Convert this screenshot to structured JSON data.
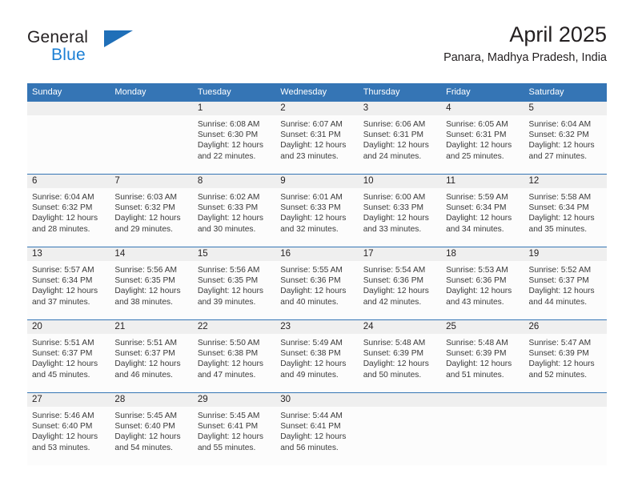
{
  "brand": {
    "name_part1": "General",
    "name_part2": "Blue",
    "accent_color": "#1f6fb8",
    "blue_text_color": "#1b7fd4",
    "logo_icon": "triangle-icon"
  },
  "header": {
    "title": "April 2025",
    "subtitle": "Panara, Madhya Pradesh, India"
  },
  "theme": {
    "header_blue": "#3575b5",
    "daynum_band_gray": "#efefef",
    "cell_background": "#fcfcfc"
  },
  "calendar": {
    "weekday_headers": [
      "Sunday",
      "Monday",
      "Tuesday",
      "Wednesday",
      "Thursday",
      "Friday",
      "Saturday"
    ],
    "weeks": [
      [
        {
          "day": "",
          "sunrise": "",
          "sunset": "",
          "daylight": ""
        },
        {
          "day": "",
          "sunrise": "",
          "sunset": "",
          "daylight": ""
        },
        {
          "day": "1",
          "sunrise": "Sunrise: 6:08 AM",
          "sunset": "Sunset: 6:30 PM",
          "daylight": "Daylight: 12 hours and 22 minutes."
        },
        {
          "day": "2",
          "sunrise": "Sunrise: 6:07 AM",
          "sunset": "Sunset: 6:31 PM",
          "daylight": "Daylight: 12 hours and 23 minutes."
        },
        {
          "day": "3",
          "sunrise": "Sunrise: 6:06 AM",
          "sunset": "Sunset: 6:31 PM",
          "daylight": "Daylight: 12 hours and 24 minutes."
        },
        {
          "day": "4",
          "sunrise": "Sunrise: 6:05 AM",
          "sunset": "Sunset: 6:31 PM",
          "daylight": "Daylight: 12 hours and 25 minutes."
        },
        {
          "day": "5",
          "sunrise": "Sunrise: 6:04 AM",
          "sunset": "Sunset: 6:32 PM",
          "daylight": "Daylight: 12 hours and 27 minutes."
        }
      ],
      [
        {
          "day": "6",
          "sunrise": "Sunrise: 6:04 AM",
          "sunset": "Sunset: 6:32 PM",
          "daylight": "Daylight: 12 hours and 28 minutes."
        },
        {
          "day": "7",
          "sunrise": "Sunrise: 6:03 AM",
          "sunset": "Sunset: 6:32 PM",
          "daylight": "Daylight: 12 hours and 29 minutes."
        },
        {
          "day": "8",
          "sunrise": "Sunrise: 6:02 AM",
          "sunset": "Sunset: 6:33 PM",
          "daylight": "Daylight: 12 hours and 30 minutes."
        },
        {
          "day": "9",
          "sunrise": "Sunrise: 6:01 AM",
          "sunset": "Sunset: 6:33 PM",
          "daylight": "Daylight: 12 hours and 32 minutes."
        },
        {
          "day": "10",
          "sunrise": "Sunrise: 6:00 AM",
          "sunset": "Sunset: 6:33 PM",
          "daylight": "Daylight: 12 hours and 33 minutes."
        },
        {
          "day": "11",
          "sunrise": "Sunrise: 5:59 AM",
          "sunset": "Sunset: 6:34 PM",
          "daylight": "Daylight: 12 hours and 34 minutes."
        },
        {
          "day": "12",
          "sunrise": "Sunrise: 5:58 AM",
          "sunset": "Sunset: 6:34 PM",
          "daylight": "Daylight: 12 hours and 35 minutes."
        }
      ],
      [
        {
          "day": "13",
          "sunrise": "Sunrise: 5:57 AM",
          "sunset": "Sunset: 6:34 PM",
          "daylight": "Daylight: 12 hours and 37 minutes."
        },
        {
          "day": "14",
          "sunrise": "Sunrise: 5:56 AM",
          "sunset": "Sunset: 6:35 PM",
          "daylight": "Daylight: 12 hours and 38 minutes."
        },
        {
          "day": "15",
          "sunrise": "Sunrise: 5:56 AM",
          "sunset": "Sunset: 6:35 PM",
          "daylight": "Daylight: 12 hours and 39 minutes."
        },
        {
          "day": "16",
          "sunrise": "Sunrise: 5:55 AM",
          "sunset": "Sunset: 6:36 PM",
          "daylight": "Daylight: 12 hours and 40 minutes."
        },
        {
          "day": "17",
          "sunrise": "Sunrise: 5:54 AM",
          "sunset": "Sunset: 6:36 PM",
          "daylight": "Daylight: 12 hours and 42 minutes."
        },
        {
          "day": "18",
          "sunrise": "Sunrise: 5:53 AM",
          "sunset": "Sunset: 6:36 PM",
          "daylight": "Daylight: 12 hours and 43 minutes."
        },
        {
          "day": "19",
          "sunrise": "Sunrise: 5:52 AM",
          "sunset": "Sunset: 6:37 PM",
          "daylight": "Daylight: 12 hours and 44 minutes."
        }
      ],
      [
        {
          "day": "20",
          "sunrise": "Sunrise: 5:51 AM",
          "sunset": "Sunset: 6:37 PM",
          "daylight": "Daylight: 12 hours and 45 minutes."
        },
        {
          "day": "21",
          "sunrise": "Sunrise: 5:51 AM",
          "sunset": "Sunset: 6:37 PM",
          "daylight": "Daylight: 12 hours and 46 minutes."
        },
        {
          "day": "22",
          "sunrise": "Sunrise: 5:50 AM",
          "sunset": "Sunset: 6:38 PM",
          "daylight": "Daylight: 12 hours and 47 minutes."
        },
        {
          "day": "23",
          "sunrise": "Sunrise: 5:49 AM",
          "sunset": "Sunset: 6:38 PM",
          "daylight": "Daylight: 12 hours and 49 minutes."
        },
        {
          "day": "24",
          "sunrise": "Sunrise: 5:48 AM",
          "sunset": "Sunset: 6:39 PM",
          "daylight": "Daylight: 12 hours and 50 minutes."
        },
        {
          "day": "25",
          "sunrise": "Sunrise: 5:48 AM",
          "sunset": "Sunset: 6:39 PM",
          "daylight": "Daylight: 12 hours and 51 minutes."
        },
        {
          "day": "26",
          "sunrise": "Sunrise: 5:47 AM",
          "sunset": "Sunset: 6:39 PM",
          "daylight": "Daylight: 12 hours and 52 minutes."
        }
      ],
      [
        {
          "day": "27",
          "sunrise": "Sunrise: 5:46 AM",
          "sunset": "Sunset: 6:40 PM",
          "daylight": "Daylight: 12 hours and 53 minutes."
        },
        {
          "day": "28",
          "sunrise": "Sunrise: 5:45 AM",
          "sunset": "Sunset: 6:40 PM",
          "daylight": "Daylight: 12 hours and 54 minutes."
        },
        {
          "day": "29",
          "sunrise": "Sunrise: 5:45 AM",
          "sunset": "Sunset: 6:41 PM",
          "daylight": "Daylight: 12 hours and 55 minutes."
        },
        {
          "day": "30",
          "sunrise": "Sunrise: 5:44 AM",
          "sunset": "Sunset: 6:41 PM",
          "daylight": "Daylight: 12 hours and 56 minutes."
        },
        {
          "day": "",
          "sunrise": "",
          "sunset": "",
          "daylight": ""
        },
        {
          "day": "",
          "sunrise": "",
          "sunset": "",
          "daylight": ""
        },
        {
          "day": "",
          "sunrise": "",
          "sunset": "",
          "daylight": ""
        }
      ]
    ]
  }
}
